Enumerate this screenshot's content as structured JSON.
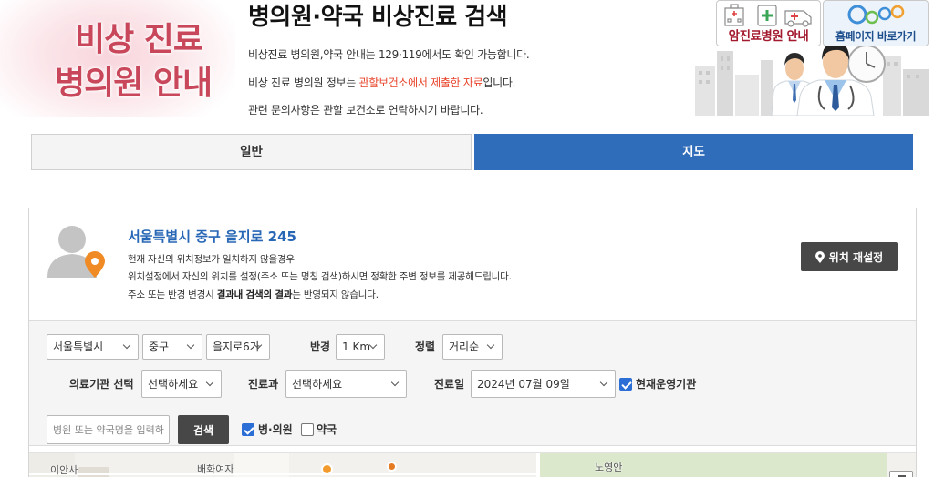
{
  "banner": {
    "line1": "비상 진료",
    "line2": "병의원 안내"
  },
  "header": {
    "title": "병의원·약국 비상진료 검색",
    "notice1": "비상진료 병의원,약국 안내는 129·119에서도 확인 가능합니다.",
    "notice2": {
      "before": "비상 진료 병의원 정보는 ",
      "highlight": "관할보건소에서 제출한 자료",
      "after": "입니다."
    },
    "notice3": "관련 문의사항은 관할 보건소로 연락하시기 바랍니다."
  },
  "quick_links": {
    "night_clinic": "암진료병원 안내",
    "homepage": "홈페이지 바로가기"
  },
  "tabs": [
    {
      "label": "일반",
      "active": false
    },
    {
      "label": "지도",
      "active": true
    }
  ],
  "location": {
    "address": "서울특별시 중구 을지로 245",
    "note1": "현재 자신의 위치정보가 일치하지 않을경우",
    "note2": "위치설정에서 자신의 위치를 설정(주소 또는 명칭 검색)하시면 정확한 주변 정보를 제공해드립니다.",
    "note3": {
      "before": "주소 또는 반경 변경시 ",
      "bold": "결과내 검색의 결과",
      "after": "는 반영되지 않습니다."
    },
    "reset_button": "위치 재설정"
  },
  "filters": {
    "sido": "서울특별시",
    "sigungu": "중구",
    "dong": "을지로6가",
    "radius_label": "반경",
    "radius": "1 Km",
    "sort_label": "정렬",
    "sort": "거리순",
    "institution_label": "의료기관 선택",
    "institution": "선택하세요",
    "department_label": "진료과",
    "department": "선택하세요",
    "date_label": "진료일",
    "date": "2024년 07월 09일",
    "open_now": {
      "label": "현재운영기관",
      "checked": true
    },
    "search_placeholder": "병원 또는 약국명을 입력하",
    "search_button": "검색",
    "hospital": {
      "label": "병·의원",
      "checked": true
    },
    "pharmacy": {
      "label": "약국",
      "checked": false
    }
  },
  "map": {
    "labels": [
      "이안사",
      "배화여자",
      "노영안"
    ]
  },
  "icons": [
    "hospital-icon",
    "pharmacy-icon",
    "ambulance-icon",
    "homepage-logo",
    "user-avatar-icon",
    "location-pin-icon",
    "chevron-down-icon",
    "clock-icon"
  ],
  "colors": {
    "accent": "#2f6cb9",
    "address": "#2767b5",
    "banner": "#c8475a",
    "highlight": "#e8432a",
    "dark_button": "#474747",
    "checkbox": "#2b6fd6",
    "link_red": "#a3192e",
    "link_blue": "#1d4f8e"
  }
}
